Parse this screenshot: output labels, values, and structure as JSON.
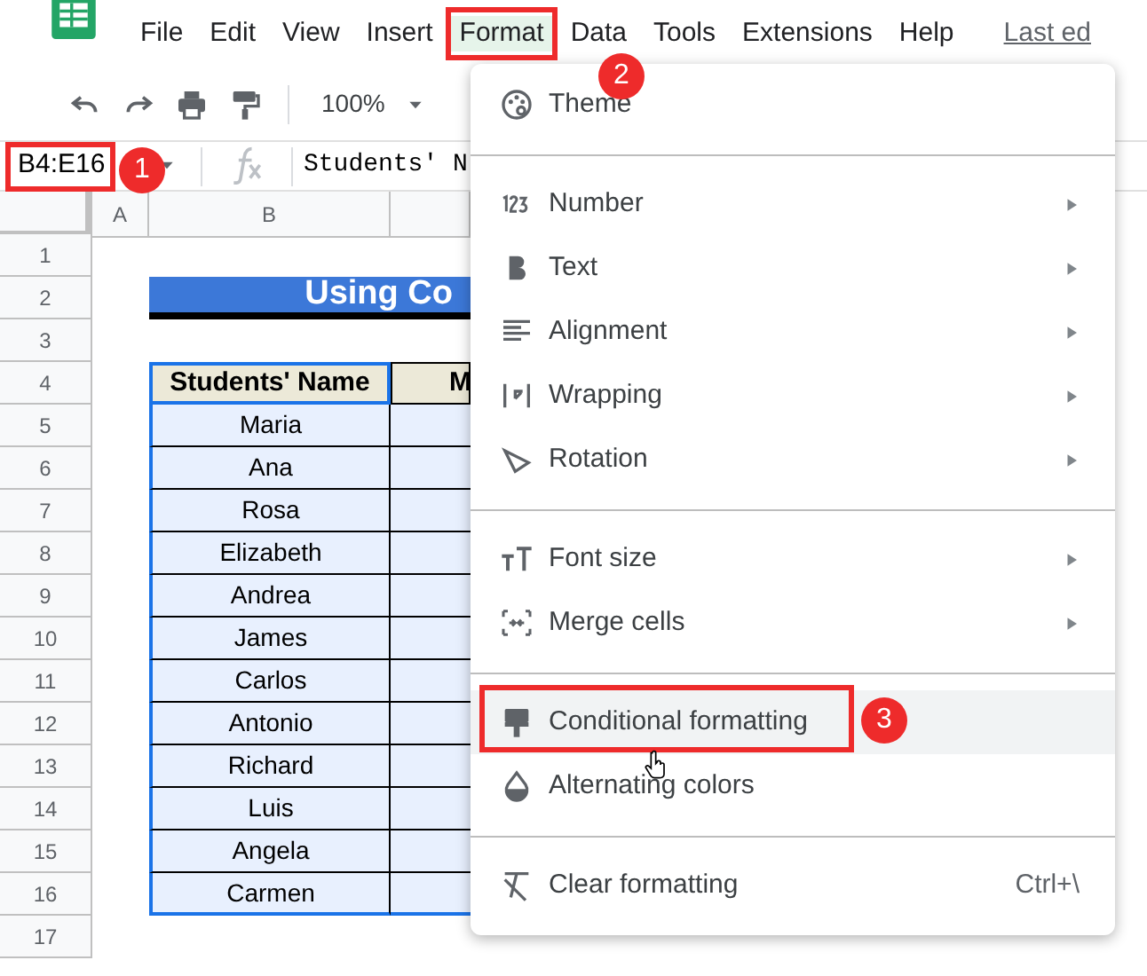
{
  "menubar": {
    "items": [
      {
        "label": "File",
        "selected": false
      },
      {
        "label": "Edit",
        "selected": false
      },
      {
        "label": "View",
        "selected": false
      },
      {
        "label": "Insert",
        "selected": false
      },
      {
        "label": "Format",
        "selected": true
      },
      {
        "label": "Data",
        "selected": false
      },
      {
        "label": "Tools",
        "selected": false
      },
      {
        "label": "Extensions",
        "selected": false
      },
      {
        "label": "Help",
        "selected": false
      }
    ],
    "last_edit": "Last ed"
  },
  "toolbar": {
    "zoom": "100%"
  },
  "formula_bar": {
    "name_box": "B4:E16",
    "content": "Students' N"
  },
  "sheet": {
    "columns": [
      "A",
      "B"
    ],
    "rows": [
      "1",
      "2",
      "3",
      "4",
      "5",
      "6",
      "7",
      "8",
      "9",
      "10",
      "11",
      "12",
      "13",
      "14",
      "15",
      "16",
      "17"
    ],
    "title": "Using Co",
    "headers": [
      "Students' Name",
      "M"
    ],
    "names": [
      "Maria",
      "Ana",
      "Rosa",
      "Elizabeth",
      "Andrea",
      "James",
      "Carlos",
      "Antonio",
      "Richard",
      "Luis",
      "Angela",
      "Carmen"
    ]
  },
  "format_menu": {
    "items": [
      {
        "kind": "item",
        "label": "Theme",
        "submenu": false,
        "highlighted": false
      },
      {
        "kind": "divider"
      },
      {
        "kind": "item",
        "label": "Number",
        "submenu": true,
        "highlighted": false
      },
      {
        "kind": "item",
        "label": "Text",
        "submenu": true,
        "highlighted": false
      },
      {
        "kind": "item",
        "label": "Alignment",
        "submenu": true,
        "highlighted": false
      },
      {
        "kind": "item",
        "label": "Wrapping",
        "submenu": true,
        "highlighted": false
      },
      {
        "kind": "item",
        "label": "Rotation",
        "submenu": true,
        "highlighted": false
      },
      {
        "kind": "divider"
      },
      {
        "kind": "item",
        "label": "Font size",
        "submenu": true,
        "highlighted": false
      },
      {
        "kind": "item",
        "label": "Merge cells",
        "submenu": true,
        "highlighted": false
      },
      {
        "kind": "divider"
      },
      {
        "kind": "item",
        "label": "Conditional formatting",
        "submenu": false,
        "highlighted": true
      },
      {
        "kind": "item",
        "label": "Alternating colors",
        "submenu": false,
        "highlighted": false
      },
      {
        "kind": "divider"
      },
      {
        "kind": "item",
        "label": "Clear formatting",
        "submenu": false,
        "highlighted": false,
        "shortcut": "Ctrl+\\"
      }
    ]
  },
  "callouts": [
    "1",
    "2",
    "3"
  ]
}
